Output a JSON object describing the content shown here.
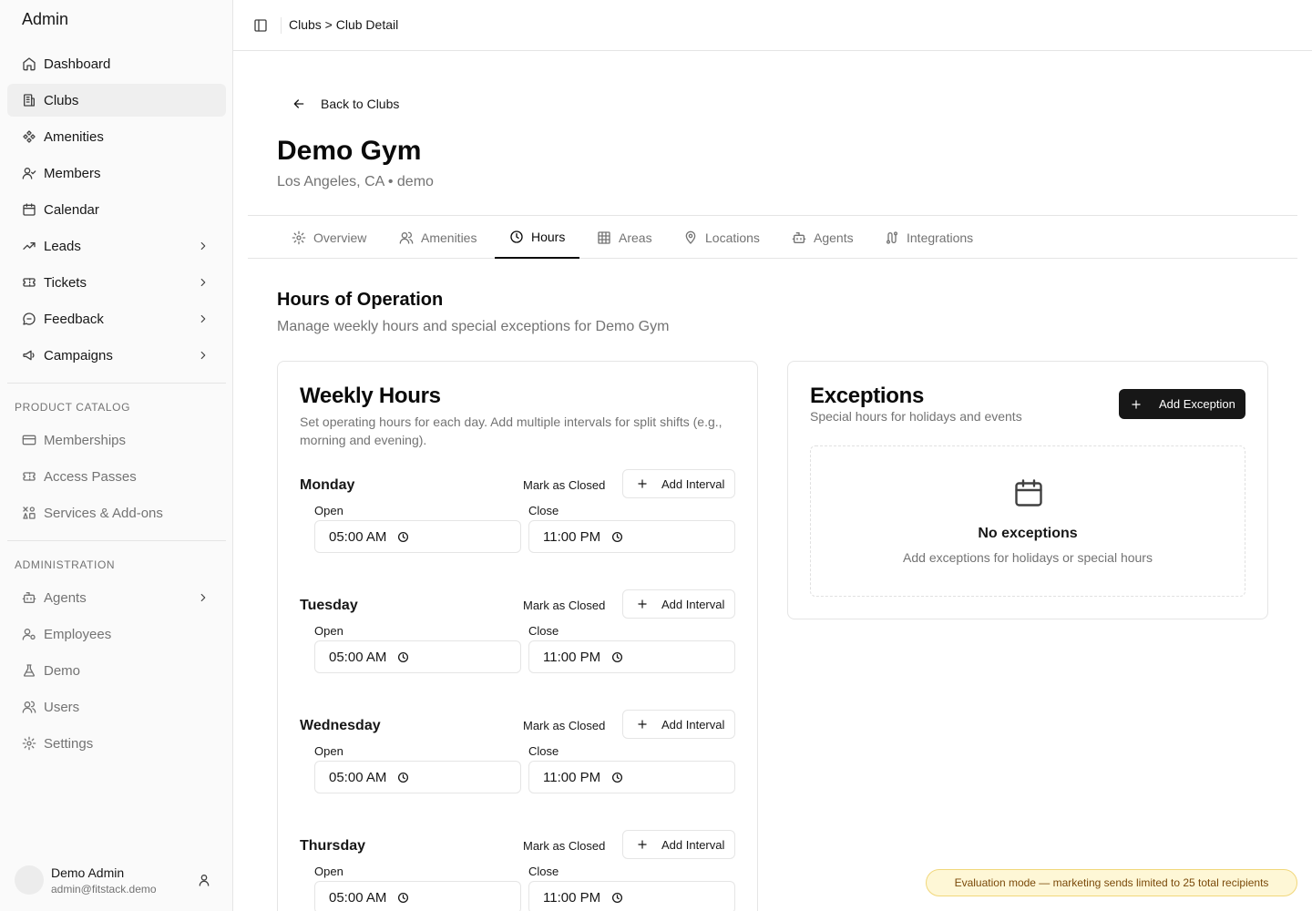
{
  "sidebar": {
    "brand": "Admin",
    "items": [
      {
        "label": "Dashboard"
      },
      {
        "label": "Clubs"
      },
      {
        "label": "Amenities"
      },
      {
        "label": "Members"
      },
      {
        "label": "Calendar"
      },
      {
        "label": "Leads"
      },
      {
        "label": "Tickets"
      },
      {
        "label": "Feedback"
      },
      {
        "label": "Campaigns"
      }
    ],
    "catalog_label": "PRODUCT CATALOG",
    "catalog_items": [
      {
        "label": "Memberships"
      },
      {
        "label": "Access Passes"
      },
      {
        "label": "Services & Add-ons"
      }
    ],
    "admin_label": "ADMINISTRATION",
    "admin_items": [
      {
        "label": "Agents"
      },
      {
        "label": "Employees"
      },
      {
        "label": "Demo"
      },
      {
        "label": "Users"
      },
      {
        "label": "Settings"
      }
    ],
    "user": {
      "name": "Demo Admin",
      "email": "admin@fitstack.demo"
    }
  },
  "header": {
    "breadcrumb": "Clubs > Club Detail"
  },
  "page": {
    "back_label": "Back to Clubs",
    "title": "Demo Gym",
    "subtitle": "Los Angeles, CA • demo",
    "tabs": [
      {
        "label": "Overview"
      },
      {
        "label": "Amenities"
      },
      {
        "label": "Hours"
      },
      {
        "label": "Areas"
      },
      {
        "label": "Locations"
      },
      {
        "label": "Agents"
      },
      {
        "label": "Integrations"
      }
    ],
    "section_title": "Hours of Operation",
    "section_subtitle": "Manage weekly hours and special exceptions for Demo Gym"
  },
  "weekly": {
    "title": "Weekly Hours",
    "description": "Set operating hours for each day. Add multiple intervals for split shifts (e.g., morning and evening).",
    "mark_closed_label": "Mark as Closed",
    "add_interval_label": "Add Interval",
    "open_label": "Open",
    "close_label": "Close",
    "days": [
      {
        "name": "Monday",
        "open": "05:00 AM",
        "close": "11:00 PM"
      },
      {
        "name": "Tuesday",
        "open": "05:00 AM",
        "close": "11:00 PM"
      },
      {
        "name": "Wednesday",
        "open": "05:00 AM",
        "close": "11:00 PM"
      },
      {
        "name": "Thursday",
        "open": "05:00 AM",
        "close": "11:00 PM"
      }
    ]
  },
  "exceptions": {
    "title": "Exceptions",
    "description": "Special hours for holidays and events",
    "add_label": "Add Exception",
    "empty_title": "No exceptions",
    "empty_subtitle": "Add exceptions for holidays or special hours"
  },
  "toast": {
    "text": "Evaluation mode — marketing sends limited to 25 total recipients"
  }
}
